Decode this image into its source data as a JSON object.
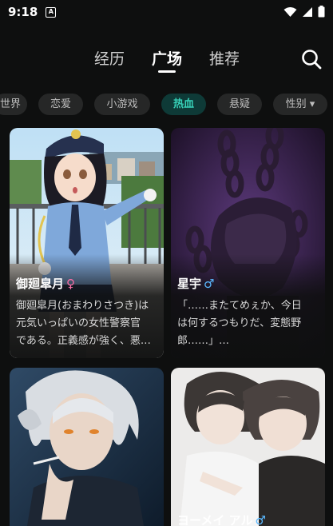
{
  "status_bar": {
    "time": "9:18",
    "app_icon_letter": "A"
  },
  "nav": {
    "tabs": [
      {
        "label": "经历",
        "active": false
      },
      {
        "label": "广场",
        "active": true
      },
      {
        "label": "推荐",
        "active": false
      }
    ]
  },
  "filters": [
    {
      "label": "世界",
      "active": false
    },
    {
      "label": "恋爱",
      "active": false
    },
    {
      "label": "小游戏",
      "active": false
    },
    {
      "label": "热血",
      "active": true
    },
    {
      "label": "悬疑",
      "active": false
    },
    {
      "label": "性别 ▾",
      "active": false
    }
  ],
  "cards": [
    {
      "name": "御廻皐月",
      "gender": "♀",
      "gender_color": "#ff6fa8",
      "description": "御廻皐月(おまわりさつき)は\n元気いっぱいの女性警察官\nである。正義感が強く、悪…"
    },
    {
      "name": "星宇",
      "gender": "♂",
      "gender_color": "#5ab8ff",
      "description": "「……またてめぇか、今日\nは何するつもりだ、変態野\n郎……」…"
    },
    {
      "name": "",
      "gender": "",
      "gender_color": "#5ab8ff",
      "description": ""
    },
    {
      "name": "ヨーメイ アル",
      "gender": "♂",
      "gender_color": "#5ab8ff",
      "description": ""
    }
  ],
  "colors": {
    "background": "#0e0f0f",
    "accent": "#37d1b8",
    "chip_bg": "#262727"
  }
}
